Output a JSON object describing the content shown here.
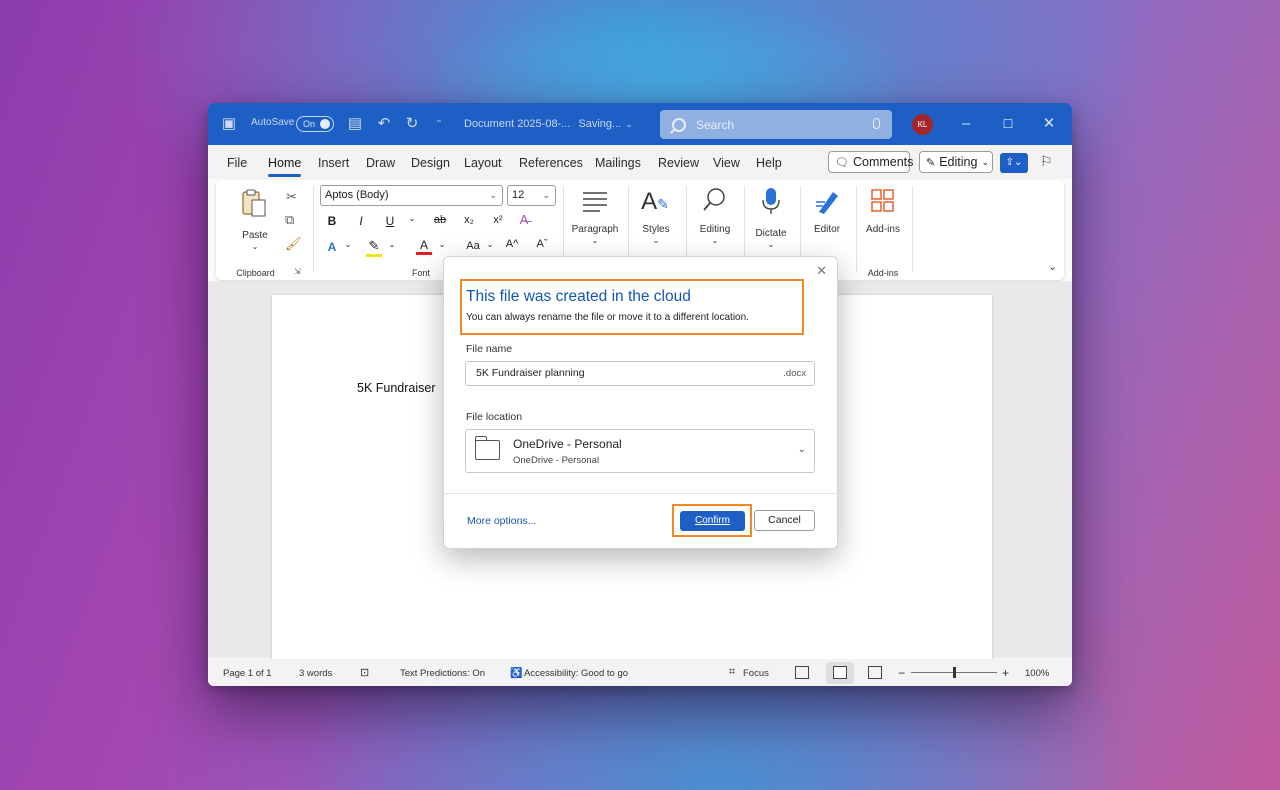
{
  "titlebar": {
    "autosave_label": "AutoSave",
    "autosave_state": "On",
    "doc_title": "Document 2025-08-...",
    "save_status": "Saving...",
    "search_placeholder": "Search",
    "avatar_initials": "KL"
  },
  "menu": {
    "tabs": [
      "File",
      "Home",
      "Insert",
      "Draw",
      "Design",
      "Layout",
      "References",
      "Mailings",
      "Review",
      "View",
      "Help"
    ],
    "active_tab": "Home",
    "comments_label": "Comments",
    "editing_label": "Editing"
  },
  "ribbon": {
    "paste_label": "Paste",
    "clipboard_label": "Clipboard",
    "font_name": "Aptos (Body)",
    "font_size": "12",
    "font_label": "Font",
    "bold": "B",
    "italic": "I",
    "underline": "U",
    "strike": "ab",
    "subscript": "x₂",
    "superscript": "x²",
    "font_color_glyph": "A",
    "case_glyph": "Aa",
    "grow_glyph": "A^",
    "shrink_glyph": "Aˇ",
    "paragraph_label": "Paragraph",
    "styles_label": "Styles",
    "editing_label": "Editing",
    "dictate_label": "Dictate",
    "editor_label": "Editor",
    "addins_label": "Add-ins",
    "addins_group_label": "Add-ins"
  },
  "document": {
    "body_text": "5K Fundraiser"
  },
  "statusbar": {
    "page": "Page 1 of 1",
    "words": "3 words",
    "predictions": "Text Predictions: On",
    "accessibility": "Accessibility: Good to go",
    "focus": "Focus",
    "zoom": "100%",
    "zoom_minus": "−",
    "zoom_plus": "+"
  },
  "dialog": {
    "title": "This file was created in the cloud",
    "subtitle": "You can always rename the file or move it to a different location.",
    "file_name_label": "File name",
    "file_name_value": "5K Fundraiser planning",
    "file_extension": ".docx",
    "file_location_label": "File location",
    "location_main": "OneDrive - Personal",
    "location_sub": "OneDrive - Personal",
    "more_options": "More options...",
    "confirm": "Confirm",
    "cancel": "Cancel"
  },
  "colors": {
    "titlebar": "#1d5fc4",
    "accent": "#1455b8",
    "highlight": "#f08a24",
    "avatar": "#a4262c"
  }
}
